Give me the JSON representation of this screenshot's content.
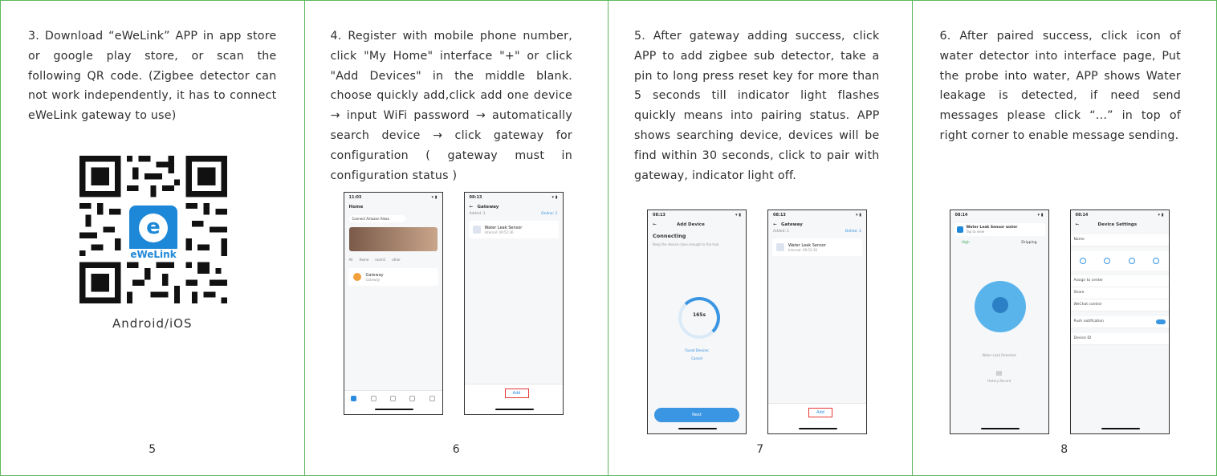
{
  "panels": [
    {
      "text": "3. Download “eWeLink” APP in app store or google play store, or scan the following QR code. (Zigbee detector can not work independently, it has to connect eWeLink gateway to use)",
      "qr_caption": "Android/iOS",
      "logo_letter": "e",
      "logo_text": "eWeLink",
      "page": "5"
    },
    {
      "text": "4. Register with mobile phone number, click \"My Home\" interface \"+\" or click \"Add Devices\" in the middle blank. choose quickly add,click add one device → input WiFi password → automatically search device → click gateway for configuration ( gateway must in configuration status )",
      "page": "6",
      "phone_a": {
        "time": "11:03",
        "title": "Home",
        "chip": "Connect Amazon Alexa",
        "tabs": [
          "All",
          "Home",
          "room1",
          "other"
        ],
        "device": "Gateway",
        "device_sub": "Gateway"
      },
      "phone_b": {
        "time": "08:13",
        "title": "Gateway",
        "added": "Added: 1",
        "online": "Online: 1",
        "device": "Water Leak Sensor",
        "device_sub": "Internal: 09:52:36",
        "add_label": "Add"
      }
    },
    {
      "text": "5. After gateway adding success, click APP to add zigbee sub detector, take a pin to long press reset key for more than 5 seconds till indicator light flashes quickly means into pairing status. APP shows searching device, devices will be find within 30 seconds, click to pair with gateway, indicator light off.",
      "page": "7",
      "phone_a": {
        "time": "08:13",
        "title": "Add Device",
        "heading": "Connecting",
        "hint": "Keep the device close enough to the hub",
        "count": "165s",
        "found": "Found Devices",
        "cancel": "Cancel",
        "next_label": "Next"
      },
      "phone_b": {
        "time": "08:13",
        "title": "Gateway",
        "added": "Added: 1",
        "online": "Online: 1",
        "device": "Water Leak Sensor",
        "device_sub": "Internal: 09:52:36",
        "add_label": "Add"
      }
    },
    {
      "text": "6. After paired success, click icon of water detector into interface page, Put the probe into water, APP shows Water leakage is detected, if need send messages please click “...” in top of right corner to enable message sending.",
      "page": "8",
      "phone_a": {
        "time": "08:14",
        "notif_title": "Water Leak Sensor water",
        "notif_sub": "Tap to view",
        "left_label": "High",
        "right_label": "Dripping",
        "status": "Water Leak Detected",
        "history": "History Record"
      },
      "phone_b": {
        "time": "08:14",
        "title": "Device Settings",
        "rows": [
          "Name",
          "Assign to center",
          "Share",
          "WeChat control",
          "Push notification",
          "Device ID"
        ]
      }
    }
  ]
}
